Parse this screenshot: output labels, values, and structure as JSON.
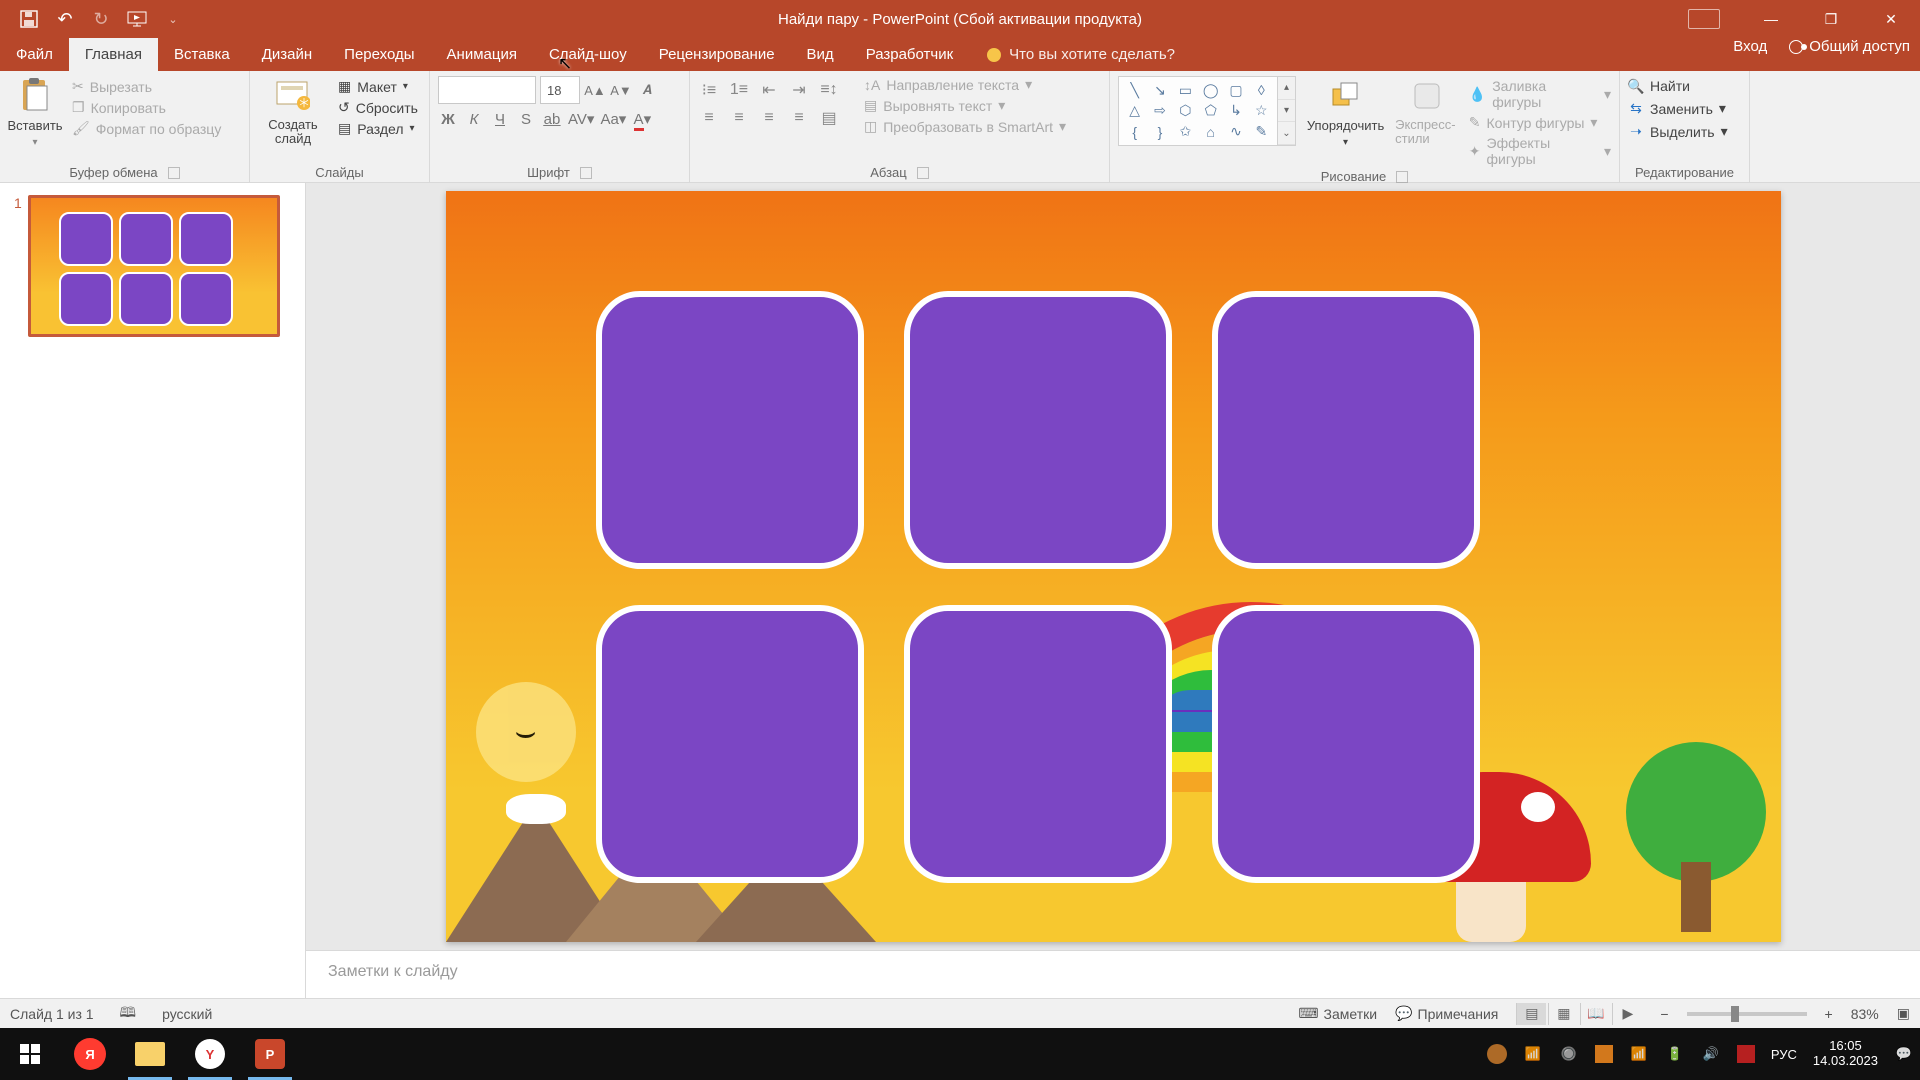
{
  "titlebar": {
    "title": "Найди пару - PowerPoint (Сбой активации продукта)"
  },
  "tabs": {
    "file": "Файл",
    "home": "Главная",
    "insert": "Вставка",
    "design": "Дизайн",
    "transitions": "Переходы",
    "animation": "Анимация",
    "slideshow": "Слайд-шоу",
    "review": "Рецензирование",
    "view": "Вид",
    "developer": "Разработчик",
    "tellme": "Что вы хотите сделать?",
    "signin": "Вход",
    "share": "Общий доступ"
  },
  "ribbon": {
    "clipboard": {
      "label": "Буфер обмена",
      "paste": "Вставить",
      "cut": "Вырезать",
      "copy": "Копировать",
      "format_painter": "Формат по образцу"
    },
    "slides": {
      "label": "Слайды",
      "new_slide": "Создать слайд",
      "layout": "Макет",
      "reset": "Сбросить",
      "section": "Раздел"
    },
    "font": {
      "label": "Шрифт",
      "size": "18"
    },
    "paragraph": {
      "label": "Абзац",
      "text_direction": "Направление текста",
      "align_text": "Выровнять текст",
      "smartart": "Преобразовать в SmartArt"
    },
    "drawing": {
      "label": "Рисование",
      "arrange": "Упорядочить",
      "quick_styles": "Экспресс-стили",
      "shape_fill": "Заливка фигуры",
      "shape_outline": "Контур фигуры",
      "shape_effects": "Эффекты фигуры"
    },
    "editing": {
      "label": "Редактирование",
      "find": "Найти",
      "replace": "Заменить",
      "select": "Выделить"
    }
  },
  "notes": {
    "placeholder": "Заметки к слайду"
  },
  "statusbar": {
    "slide_info": "Слайд 1 из 1",
    "language": "русский",
    "notes": "Заметки",
    "comments": "Примечания",
    "zoom": "83%"
  },
  "taskbar": {
    "lang": "РУС",
    "time": "16:05",
    "date": "14.03.2023"
  }
}
